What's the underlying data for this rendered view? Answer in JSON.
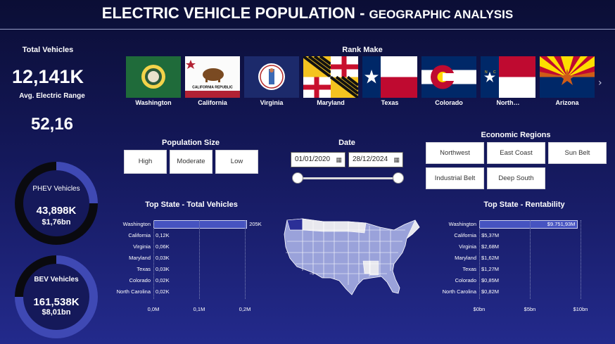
{
  "header": {
    "title_main": "ELECTRIC VEHICLE POPULATION",
    "title_sub": "GEOGRAPHIC ANALYSIS"
  },
  "kpis": {
    "total_vehicles_label": "Total Vehicles",
    "total_vehicles_value": "12,141K",
    "avg_range_label": "Avg. Electric Range",
    "avg_range_value": "52,16"
  },
  "phev": {
    "label": "PHEV Vehicles",
    "count": "43,898K",
    "amount": "$1,76bn",
    "share": 0.25
  },
  "bev": {
    "label": "BEV Vehicles",
    "count": "161,538K",
    "amount": "$8,01bn",
    "share": 0.75
  },
  "rank_make": {
    "title": "Rank Make",
    "flags": [
      {
        "name": "Washington",
        "icon": "washington-flag-icon"
      },
      {
        "name": "California",
        "icon": "california-flag-icon"
      },
      {
        "name": "Virginia",
        "icon": "virginia-flag-icon"
      },
      {
        "name": "Maryland",
        "icon": "maryland-flag-icon"
      },
      {
        "name": "Texas",
        "icon": "texas-flag-icon"
      },
      {
        "name": "Colorado",
        "icon": "colorado-flag-icon"
      },
      {
        "name": "North…",
        "icon": "north-carolina-flag-icon"
      },
      {
        "name": "Arizona",
        "icon": "arizona-flag-icon"
      }
    ],
    "next_icon": "chevron-right-icon"
  },
  "population_size": {
    "title": "Population Size",
    "options": [
      "High",
      "Moderate",
      "Low"
    ]
  },
  "date": {
    "title": "Date",
    "start": "01/01/2020",
    "end": "28/12/2024",
    "calendar_icon": "calendar-icon"
  },
  "economic_regions": {
    "title": "Economic Regions",
    "options": [
      "Northwest",
      "East Coast",
      "Sun Belt",
      "Industrial Belt",
      "Deep South"
    ]
  },
  "chart_data": [
    {
      "type": "bar",
      "title": "Top State - Total Vehicles",
      "categories": [
        "Washington",
        "California",
        "Virginia",
        "Maryland",
        "Texas",
        "Colorado",
        "North Carolina"
      ],
      "values": [
        205000,
        120,
        60,
        30,
        30,
        20,
        20
      ],
      "labels": [
        "205K",
        "0,12K",
        "0,06K",
        "0,03K",
        "0,03K",
        "0,02K",
        "0,02K"
      ],
      "xticks": [
        "0,0M",
        "0,1M",
        "0,2M"
      ],
      "xlim": [
        0,
        200000
      ]
    },
    {
      "type": "bar",
      "title": "Top State - Rentability",
      "categories": [
        "Washington",
        "California",
        "Virginia",
        "Maryland",
        "Texas",
        "Colorado",
        "North Carolina"
      ],
      "values": [
        9751.93,
        5.37,
        2.68,
        1.62,
        1.27,
        0.85,
        0.82
      ],
      "labels": [
        "$9.751,93M",
        "$5,37M",
        "$2,68M",
        "$1,62M",
        "$1,27M",
        "$0,85M",
        "$0,82M"
      ],
      "xticks": [
        "$0bn",
        "$5bn",
        "$10bn"
      ],
      "xlim": [
        0,
        10000
      ]
    }
  ],
  "colors": {
    "accent": "#3f49b4",
    "bar_fill": "#4653c0",
    "map_fill": "#9aa2da",
    "bg": "#14185a"
  }
}
